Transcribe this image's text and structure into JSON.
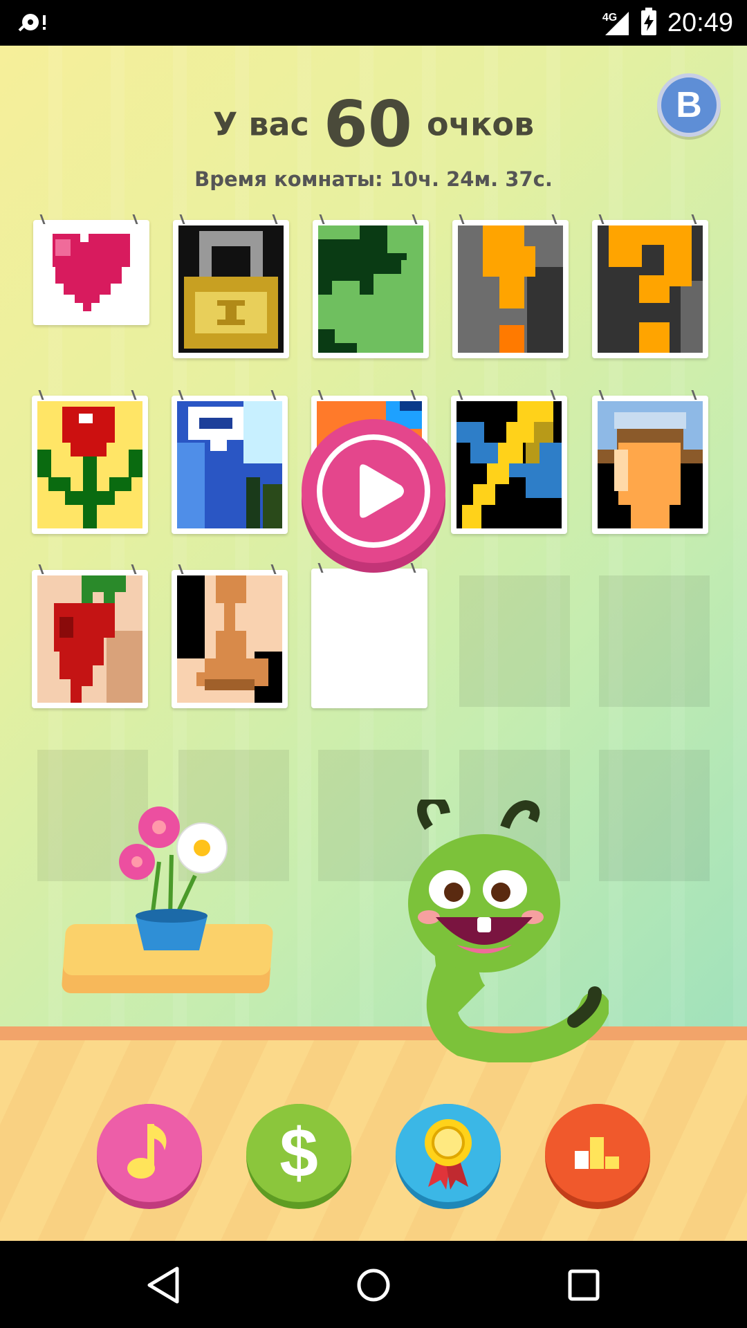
{
  "status_bar": {
    "network": "4G",
    "time": "20:49"
  },
  "header": {
    "score_prefix": "У вас",
    "score_value": "60",
    "score_suffix": "очков",
    "room_time": "Время комнаты: 10ч. 24м. 37с."
  },
  "social": {
    "vk_label": "B"
  },
  "gallery": {
    "tiles": [
      {
        "name": "heart"
      },
      {
        "name": "lock"
      },
      {
        "name": "leaf"
      },
      {
        "name": "exclamation"
      },
      {
        "name": "question"
      },
      {
        "name": "rose"
      },
      {
        "name": "blue-shapes"
      },
      {
        "name": "orange-blue"
      },
      {
        "name": "lightning"
      },
      {
        "name": "vase"
      },
      {
        "name": "strawberry"
      },
      {
        "name": "chess-pawn"
      },
      {
        "name": "blank"
      }
    ],
    "play_icon": "play-icon"
  },
  "toolbar": {
    "music_icon": "music-note-icon",
    "shop_label": "$",
    "award_icon": "award-medal-icon",
    "leaderboard_icon": "leaderboard-icon"
  },
  "colors": {
    "accent_pink": "#e4468c",
    "music": "#ed5ea8",
    "shop": "#8bc63c",
    "award": "#3bb7e6",
    "leaderboard": "#f0592c"
  }
}
